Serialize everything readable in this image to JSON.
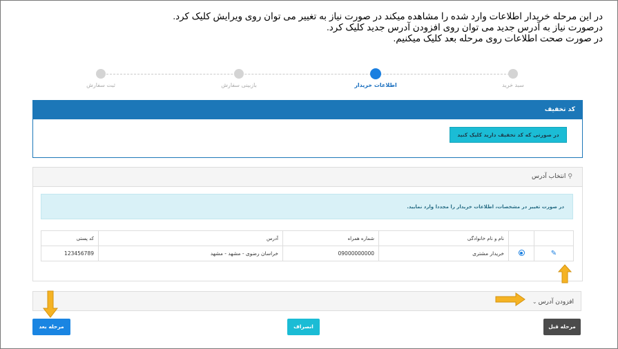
{
  "instructions": {
    "line1": "در این مرحله خریدار اطلاعات وارد شده را مشاهده میکند در صورت نیاز به تغییر می توان روی ویرایش کلیک کرد.",
    "line2": "درصورت نیاز به آدرس جدید می توان روی افزودن آدرس جدید کلیک کرد.",
    "line3": "در صورت صحت اطلاعات روی مرحله بعد کلیک میکنیم."
  },
  "stepper": {
    "steps": [
      {
        "label": "سبد خرید",
        "active": false
      },
      {
        "label": "اطلاعات خریدار",
        "active": true
      },
      {
        "label": "بازبینی سفارش",
        "active": false
      },
      {
        "label": "ثبت سفارش",
        "active": false
      }
    ],
    "active_color": "#1a7fe0",
    "inactive_color": "#d4d4d4"
  },
  "discount": {
    "title": "کد تخفیف",
    "button_label": "در صورتی که کد تخفیف دارید کلیک کنید"
  },
  "address": {
    "title": "انتخاب آدرس",
    "alert": "در صورت تغییر در مشخصات، اطلاعات خریدار را مجددا وارد نمایید.",
    "columns": [
      "",
      "",
      "نام و نام خانوادگی",
      "شماره همراه",
      "آدرس",
      "کد پستی"
    ],
    "rows": [
      {
        "name": "خریدار مشتری",
        "mobile": "09000000000",
        "address": "خراسان رضوی - مشهد - مشهد",
        "postal": "123456789"
      }
    ]
  },
  "add_address": {
    "label": "افزودن آدرس"
  },
  "buttons": {
    "next": "مرحله بعد",
    "cancel": "انصراف",
    "prev": "مرحله قبل"
  },
  "colors": {
    "primary": "#1c77b8",
    "accent": "#1bbcd5",
    "arrow": "#f5b324"
  }
}
